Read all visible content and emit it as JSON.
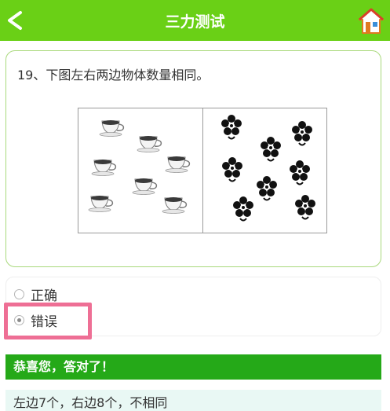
{
  "header": {
    "title": "三力测试",
    "back_label": "<",
    "bar_color": "#6ad016"
  },
  "question": {
    "text": "19、下图左右两边物体数量相同。",
    "image": {
      "left_item": "teacup-icon",
      "left_count": 7,
      "right_item": "flower-icon",
      "right_count": 8
    }
  },
  "options": [
    {
      "label": "正确",
      "selected": false
    },
    {
      "label": "错误",
      "selected": true
    }
  ],
  "result": {
    "message": "恭喜您，答对了！",
    "color": "#25a918"
  },
  "explanation": {
    "text": "左边7个，右边8个，不相同"
  }
}
